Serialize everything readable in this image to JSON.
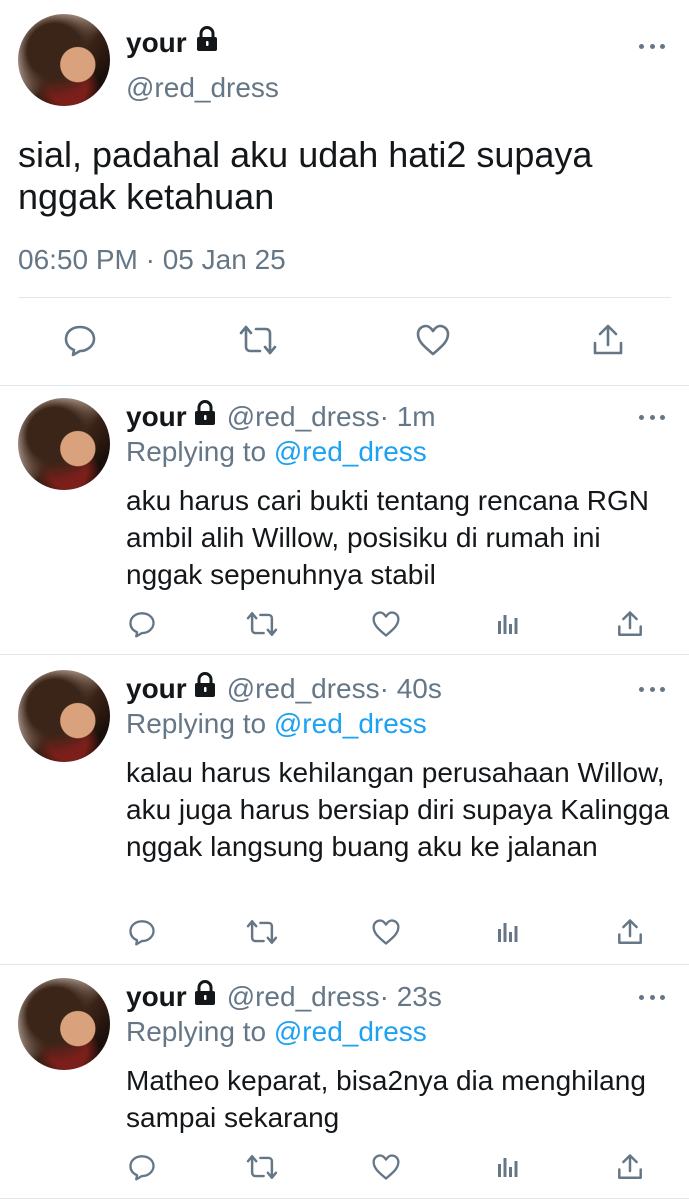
{
  "main_tweet": {
    "name": "your",
    "handle": "@red_dress",
    "text": "sial, padahal aku udah hati2 supaya nggak ketahuan",
    "timestamp": "06:50 PM · 05 Jan 25",
    "icons": [
      "reply-icon",
      "retweet-icon",
      "like-icon",
      "share-icon"
    ]
  },
  "replies": [
    {
      "name": "your",
      "handle": "@red_dress",
      "time": " · 1m",
      "replying_prefix": "Replying to ",
      "replying_handle": "@red_dress",
      "text": "aku harus cari bukti tentang rencana RGN ambil alih Willow, posisiku di rumah ini nggak sepenuhnya stabil"
    },
    {
      "name": "your",
      "handle": "@red_dress",
      "time": " · 40s",
      "replying_prefix": "Replying to ",
      "replying_handle": "@red_dress",
      "text": "kalau harus kehilangan perusahaan Willow, aku juga harus bersiap diri supaya Kalingga nggak langsung buang aku ke jalanan"
    },
    {
      "name": "your",
      "handle": "@red_dress",
      "time": " · 23s",
      "replying_prefix": "Replying to ",
      "replying_handle": "@red_dress",
      "text": "Matheo keparat, bisa2nya dia menghilang sampai sekarang"
    }
  ],
  "colors": {
    "text": "#14171a",
    "muted": "#657786",
    "link": "#1da1f2",
    "divider": "#e1e8ed"
  }
}
